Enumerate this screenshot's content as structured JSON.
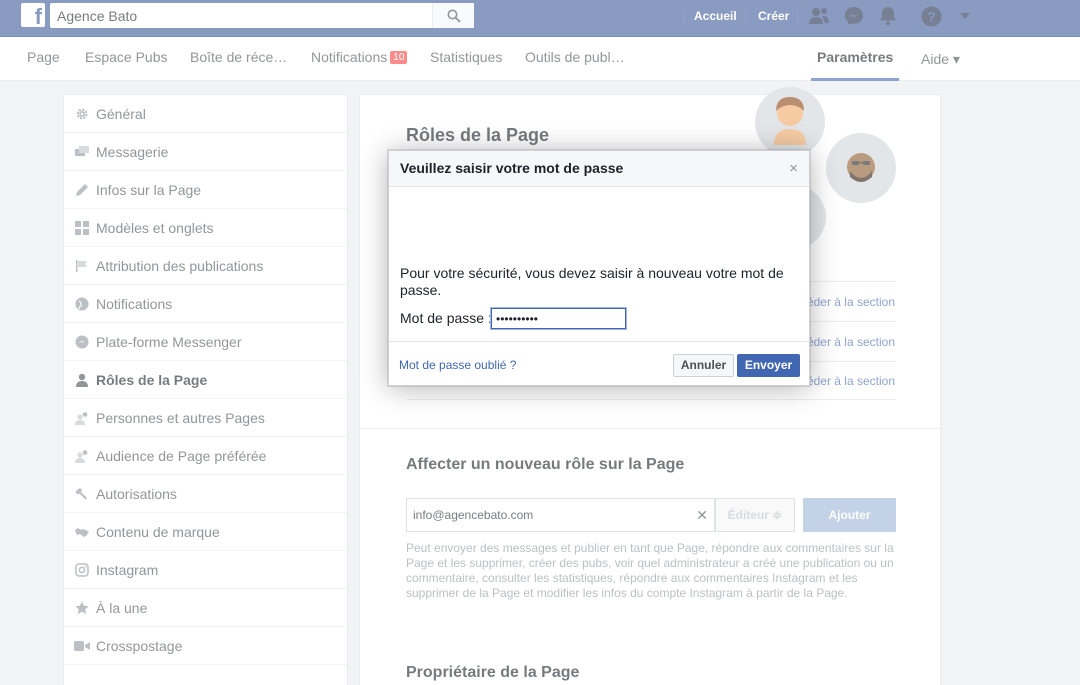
{
  "topbar": {
    "logo": "f",
    "search_value": "Agence Bato",
    "links": [
      "Accueil",
      "Créer"
    ],
    "icons": [
      "friends-icon",
      "messenger-icon",
      "bell-icon",
      "help-icon",
      "caret-down-icon"
    ]
  },
  "pagenav": {
    "items": [
      {
        "label": "Page"
      },
      {
        "label": "Espace Pubs"
      },
      {
        "label": "Boîte de réce…"
      },
      {
        "label": "Notifications",
        "badge": "10"
      },
      {
        "label": "Statistiques"
      },
      {
        "label": "Outils de publ…"
      }
    ],
    "settings": "Paramètres",
    "help": "Aide ▾"
  },
  "sidebar": {
    "items": [
      {
        "label": "Général",
        "icon": "gear-icon"
      },
      {
        "label": "Messagerie",
        "icon": "messages-icon"
      },
      {
        "label": "Infos sur la Page",
        "icon": "pencil-icon"
      },
      {
        "label": "Modèles et onglets",
        "icon": "grid-icon"
      },
      {
        "label": "Attribution des publications",
        "icon": "flag-icon"
      },
      {
        "label": "Notifications",
        "icon": "globe-icon"
      },
      {
        "label": "Plate-forme Messenger",
        "icon": "messenger-icon"
      },
      {
        "label": "Rôles de la Page",
        "icon": "person-icon",
        "active": true
      },
      {
        "label": "Personnes et autres Pages",
        "icon": "people-icon"
      },
      {
        "label": "Audience de Page préférée",
        "icon": "people-icon"
      },
      {
        "label": "Autorisations",
        "icon": "wrench-icon"
      },
      {
        "label": "Contenu de marque",
        "icon": "handshake-icon"
      },
      {
        "label": "Instagram",
        "icon": "instagram-icon"
      },
      {
        "label": "À la une",
        "icon": "star-icon"
      },
      {
        "label": "Crosspostage",
        "icon": "video-icon"
      }
    ]
  },
  "main": {
    "roles_title": "Rôles de la Page",
    "section_link": "éder à la section",
    "assign_title": "Affecter un nouveau rôle sur la Page",
    "email_value": "info@agencebato.com",
    "role_select": "Éditeur ≑",
    "add_button": "Ajouter",
    "description": "Peut envoyer des messages et publier en tant que Page, répondre aux commentaires sur la Page et les supprimer, créer des pubs, voir quel administrateur a créé une publication ou un commentaire, consulter les statistiques, répondre aux commentaires Instagram et les supprimer de la Page et modifier les infos du compte Instagram à partir de la Page.",
    "owner_title": "Propriétaire de la Page"
  },
  "dialog": {
    "title": "Veuillez saisir votre mot de passe",
    "close": "×",
    "text": "Pour votre sécurité, vous devez saisir à nouveau votre mot de passe.",
    "password_label": "Mot de passe :",
    "password_value": "••••••••••",
    "forgot_link": "Mot de passe oublié ?",
    "cancel_button": "Annuler",
    "send_button": "Envoyer"
  },
  "colors": {
    "brand_blue": "#3b5998",
    "link_blue": "#4267b2",
    "badge_red": "#fa3e3e"
  }
}
